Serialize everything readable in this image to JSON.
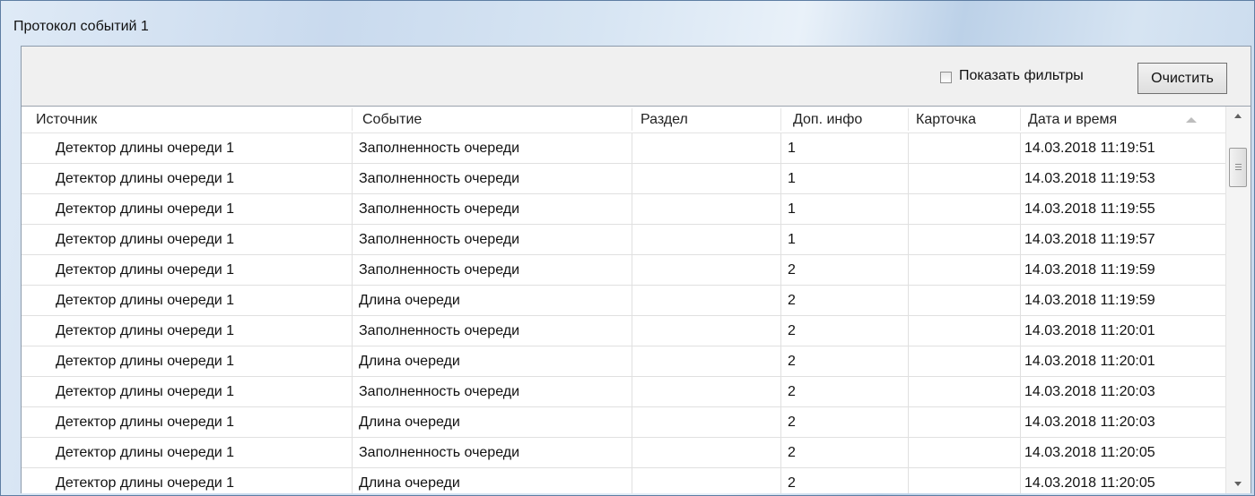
{
  "window": {
    "title": "Протокол событий 1"
  },
  "toolbar": {
    "show_filters_label": "Показать фильтры",
    "show_filters_checked": false,
    "clear_button_label": "Очистить"
  },
  "table": {
    "columns": [
      "Источник",
      "Событие",
      "Раздел",
      "Доп. инфо",
      "Карточка",
      "Дата и время"
    ],
    "sorted_column": "Дата и время",
    "sort_direction": "ascending",
    "rows": [
      [
        "Детектор длины очереди 1",
        "Заполненность очереди",
        "",
        "1",
        "",
        "14.03.2018 11:19:51"
      ],
      [
        "Детектор длины очереди 1",
        "Заполненность очереди",
        "",
        "1",
        "",
        "14.03.2018 11:19:53"
      ],
      [
        "Детектор длины очереди 1",
        "Заполненность очереди",
        "",
        "1",
        "",
        "14.03.2018 11:19:55"
      ],
      [
        "Детектор длины очереди 1",
        "Заполненность очереди",
        "",
        "1",
        "",
        "14.03.2018 11:19:57"
      ],
      [
        "Детектор длины очереди 1",
        "Заполненность очереди",
        "",
        "2",
        "",
        "14.03.2018 11:19:59"
      ],
      [
        "Детектор длины очереди 1",
        "Длина очереди",
        "",
        "2",
        "",
        "14.03.2018 11:19:59"
      ],
      [
        "Детектор длины очереди 1",
        "Заполненность очереди",
        "",
        "2",
        "",
        "14.03.2018 11:20:01"
      ],
      [
        "Детектор длины очереди 1",
        "Длина очереди",
        "",
        "2",
        "",
        "14.03.2018 11:20:01"
      ],
      [
        "Детектор длины очереди 1",
        "Заполненность очереди",
        "",
        "2",
        "",
        "14.03.2018 11:20:03"
      ],
      [
        "Детектор длины очереди 1",
        "Длина очереди",
        "",
        "2",
        "",
        "14.03.2018 11:20:03"
      ],
      [
        "Детектор длины очереди 1",
        "Заполненность очереди",
        "",
        "2",
        "",
        "14.03.2018 11:20:05"
      ],
      [
        "Детектор длины очереди 1",
        "Длина очереди",
        "",
        "2",
        "",
        "14.03.2018 11:20:05"
      ]
    ]
  },
  "icons": {
    "sort_indicator": "sort-ascending-icon",
    "scroll_up": "scroll-up-arrow-icon",
    "scroll_down": "scroll-down-arrow-icon"
  }
}
